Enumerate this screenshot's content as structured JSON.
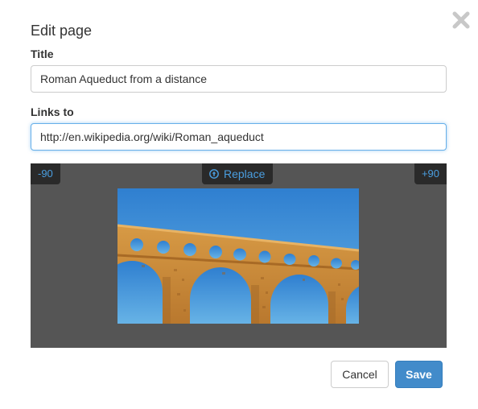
{
  "dialog": {
    "title": "Edit page",
    "close_icon": "close-icon"
  },
  "form": {
    "title_label": "Title",
    "title_value": "Roman Aqueduct from a distance",
    "links_label": "Links to",
    "links_value": "http://en.wikipedia.org/wiki/Roman_aqueduct"
  },
  "image_editor": {
    "rotate_left_label": "-90",
    "replace_label": "Replace",
    "replace_icon": "upload-icon",
    "rotate_right_label": "+90",
    "preview_subject": "aqueduct-photo"
  },
  "actions": {
    "cancel_label": "Cancel",
    "save_label": "Save"
  },
  "colors": {
    "accent": "#428bca",
    "link_blue": "#4a9ee0",
    "panel_bg": "#555555",
    "toolbar_bg": "#2a2a2a"
  }
}
